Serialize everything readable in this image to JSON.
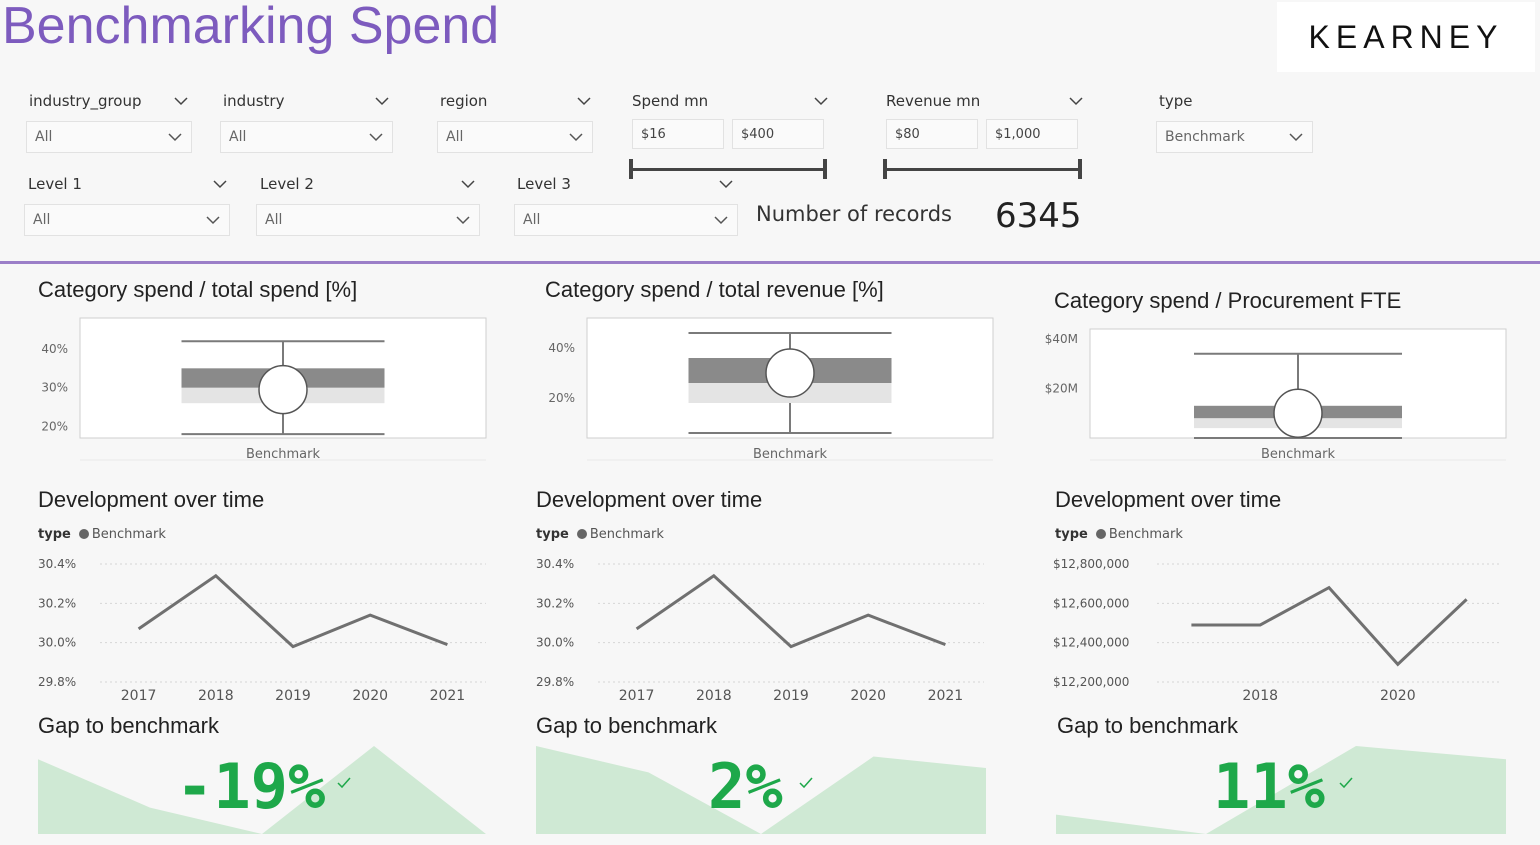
{
  "header": {
    "title": "Benchmarking Spend",
    "logo": "KEARNEY"
  },
  "filters": {
    "industry_group": {
      "label": "industry_group",
      "value": "All"
    },
    "industry": {
      "label": "industry",
      "value": "All"
    },
    "region": {
      "label": "region",
      "value": "All"
    },
    "spend": {
      "label": "Spend mn",
      "min": "$16",
      "max": "$400"
    },
    "revenue": {
      "label": "Revenue mn",
      "min": "$80",
      "max": "$1,000"
    },
    "type": {
      "label": "type",
      "value": "Benchmark"
    },
    "level1": {
      "label": "Level 1",
      "value": "All"
    },
    "level2": {
      "label": "Level 2",
      "value": "All"
    },
    "level3": {
      "label": "Level 3",
      "value": "All"
    }
  },
  "records": {
    "label": "Number of records",
    "value": "6345"
  },
  "icons": {
    "dropdown": "chevron-down-icon",
    "legend_marker": "circle-marker-icon",
    "gap_status": "checkmark-icon"
  },
  "colors": {
    "title": "#7d5bbe",
    "divider": "#9b7fc8",
    "gap_value": "#1ea84a",
    "gap_area": "#cfe9d4",
    "line": "#707070"
  },
  "panels": [
    {
      "box_title": "Category spend / total spend [%]",
      "trend_title": "Development over time",
      "gap_title": "Gap to benchmark",
      "gap_value": "-19%"
    },
    {
      "box_title": "Category spend / total revenue [%]",
      "trend_title": "Development over time",
      "gap_title": "Gap to benchmark",
      "gap_value": "2%"
    },
    {
      "box_title": "Category spend / Procurement FTE",
      "trend_title": "Development over time",
      "gap_title": "Gap to benchmark",
      "gap_value": "11%"
    }
  ],
  "chart_data": [
    {
      "type": "box",
      "title": "Category spend / total spend [%]",
      "categories": [
        "Benchmark"
      ],
      "y_ticks": [
        "40%",
        "30%",
        "20%"
      ],
      "ylim": [
        17,
        48
      ],
      "box": {
        "whisker_low": 18,
        "q1": 26,
        "inner": 30,
        "median": 29.5,
        "q3": 35,
        "whisker_high": 42
      }
    },
    {
      "type": "line",
      "title": "Development over time",
      "legend_title": "type",
      "series": [
        {
          "name": "Benchmark",
          "values": [
            30.07,
            30.34,
            29.98,
            30.14,
            29.99
          ]
        }
      ],
      "categories": [
        "2017",
        "2018",
        "2019",
        "2020",
        "2021"
      ],
      "y_ticks": [
        "30.4%",
        "30.2%",
        "30.0%",
        "29.8%"
      ],
      "ylim": [
        29.8,
        30.4
      ]
    },
    {
      "type": "area",
      "title": "Gap to benchmark",
      "values": [
        0.85,
        0.3,
        0.0,
        1.0,
        0.0
      ],
      "ylim": [
        0,
        1
      ]
    },
    {
      "type": "box",
      "title": "Category spend / total revenue [%]",
      "categories": [
        "Benchmark"
      ],
      "y_ticks": [
        "40%",
        "20%"
      ],
      "ylim": [
        4,
        52
      ],
      "box": {
        "whisker_low": 6,
        "q1": 18,
        "inner": 26,
        "median": 30,
        "q3": 36,
        "whisker_high": 46
      }
    },
    {
      "type": "line",
      "title": "Development over time",
      "legend_title": "type",
      "series": [
        {
          "name": "Benchmark",
          "values": [
            30.07,
            30.34,
            29.98,
            30.14,
            29.99
          ]
        }
      ],
      "categories": [
        "2017",
        "2018",
        "2019",
        "2020",
        "2021"
      ],
      "y_ticks": [
        "30.4%",
        "30.2%",
        "30.0%",
        "29.8%"
      ],
      "ylim": [
        29.8,
        30.4
      ]
    },
    {
      "type": "area",
      "title": "Gap to benchmark",
      "values": [
        1.0,
        0.7,
        0.0,
        0.88,
        0.75
      ],
      "ylim": [
        0,
        1
      ]
    },
    {
      "type": "box",
      "title": "Category spend / Procurement FTE",
      "categories": [
        "Benchmark"
      ],
      "y_ticks": [
        "$40M",
        "$20M"
      ],
      "ylim": [
        0,
        44
      ],
      "box": {
        "whisker_low": 0,
        "q1": 4,
        "inner": 8,
        "median": 10,
        "q3": 13,
        "whisker_high": 34
      }
    },
    {
      "type": "line",
      "title": "Development over time",
      "legend_title": "type",
      "series": [
        {
          "name": "Benchmark",
          "values": [
            12490000,
            12490000,
            12680000,
            12290000,
            12620000
          ]
        }
      ],
      "categories": [
        "2017",
        "2018",
        "2019",
        "2020",
        "2021"
      ],
      "tick_labels": [
        "2018",
        "2020"
      ],
      "y_ticks": [
        "$12,800,000",
        "$12,600,000",
        "$12,400,000",
        "$12,200,000"
      ],
      "ylim": [
        12200000,
        12800000
      ]
    },
    {
      "type": "area",
      "title": "Gap to benchmark",
      "values": [
        0.22,
        0.0,
        1.0,
        0.85
      ],
      "ylim": [
        0,
        1
      ]
    }
  ]
}
